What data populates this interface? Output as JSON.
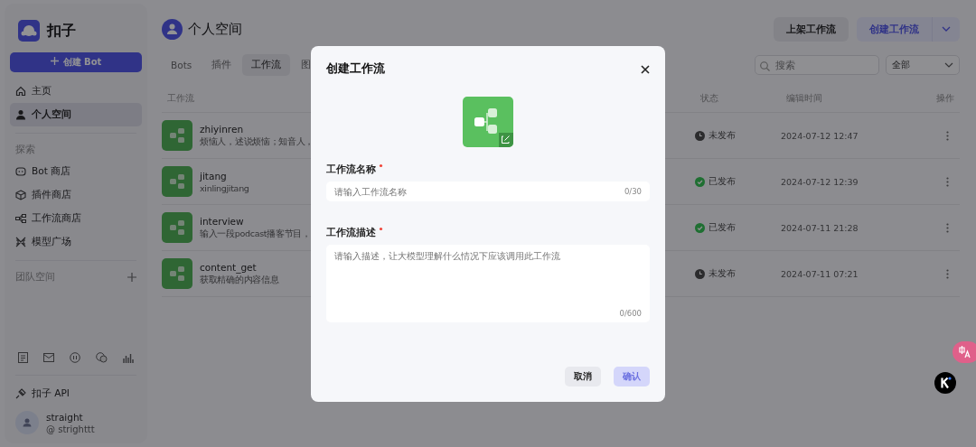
{
  "app": {
    "name": "扣子"
  },
  "sidebar": {
    "create_button": "创建 Bot",
    "nav": [
      {
        "label": "主页",
        "kind": "home",
        "selected": false
      },
      {
        "label": "个人空间",
        "kind": "user",
        "selected": true
      }
    ],
    "explore_heading": "探索",
    "explore": [
      {
        "label": "Bot 商店",
        "kind": "bot"
      },
      {
        "label": "插件商店",
        "kind": "cube"
      },
      {
        "label": "工作流商店",
        "kind": "flow"
      },
      {
        "label": "模型广场",
        "kind": "model"
      }
    ],
    "team_heading": "团队空间",
    "api": "扣子 API",
    "user": {
      "name": "straight",
      "handle": "@ strighttt"
    }
  },
  "main": {
    "title": "个人空间",
    "buttons": [
      {
        "label": "上架工作流",
        "kind": "secondary"
      },
      {
        "label": "创建工作流",
        "kind": "primary"
      }
    ],
    "tabs": [
      {
        "label": "Bots",
        "selected": false
      },
      {
        "label": "插件",
        "selected": false
      },
      {
        "label": "工作流",
        "selected": true
      },
      {
        "label": "图",
        "selected": false
      }
    ],
    "search": {
      "placeholder": "搜索"
    },
    "filter": "全部",
    "columns": [
      "工作流",
      "状态",
      "编辑时间",
      "操作"
    ],
    "rows": [
      {
        "name": "zhiyinren",
        "description": "烦恼人，述说烦恼；知音人，",
        "status": "未发布",
        "published": false,
        "time": "2024-07-12 12:47"
      },
      {
        "name": "jitang",
        "description": "xinlingjitang",
        "status": "已发布",
        "published": true,
        "time": "2024-07-12 12:39"
      },
      {
        "name": "interview",
        "description": "输入一段podcast播客节目，",
        "status": "已发布",
        "published": true,
        "time": "2024-07-11 21:28"
      },
      {
        "name": "content_get",
        "description": "获取精确的内容信息",
        "status": "未发布",
        "published": false,
        "time": "2024-07-11 07:21"
      }
    ]
  },
  "dialog": {
    "title": "创建工作流",
    "fields": [
      {
        "label": "工作流名称",
        "required": true,
        "placeholder": "请输入工作流名称",
        "counter": "0/30",
        "kind": "input"
      },
      {
        "label": "工作流描述",
        "required": true,
        "placeholder": "请输入描述，让大模型理解什么情况下应该调用此工作流",
        "counter": "0/600",
        "kind": "textarea"
      }
    ],
    "cancel": "取消",
    "confirm": {
      "label": "确认",
      "disabled": true
    }
  }
}
